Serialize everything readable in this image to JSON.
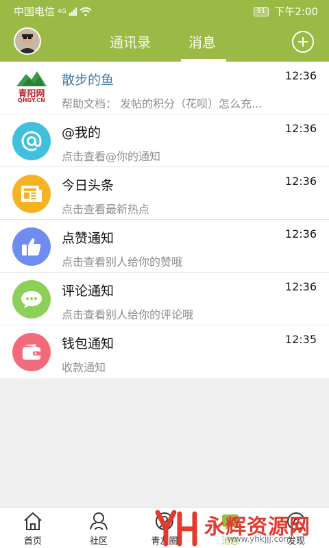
{
  "status_bar": {
    "carrier": "中国电信",
    "network": "4G",
    "battery": "91",
    "time": "下午2:00"
  },
  "header": {
    "tabs": [
      {
        "label": "通讯录",
        "active": false
      },
      {
        "label": "消息",
        "active": true
      }
    ],
    "avatar_icon": "user-avatar",
    "add_icon": "plus-circle-icon"
  },
  "messages": [
    {
      "title": "散步的鱼",
      "subtitle": "帮助文档： 发帖的积分（花呗）怎么充...",
      "time": "12:36",
      "icon": "qingyang-logo",
      "logo_text": "青阳网",
      "logo_small": "QHGY.CN"
    },
    {
      "title": "@我的",
      "subtitle": "点击查看@你的通知",
      "time": "12:36",
      "icon": "at-icon",
      "color": "#3fc0de"
    },
    {
      "title": "今日头条",
      "subtitle": "点击查看最新热点",
      "time": "12:36",
      "icon": "newspaper-icon",
      "color": "#f5b324"
    },
    {
      "title": "点赞通知",
      "subtitle": "点击查看别人给你的赞哦",
      "time": "12:36",
      "icon": "thumbs-up-icon",
      "color": "#6f8df0"
    },
    {
      "title": "评论通知",
      "subtitle": "点击查看别人给你的评论哦",
      "time": "12:36",
      "icon": "chat-bubble-icon",
      "color": "#8cd05a"
    },
    {
      "title": "钱包通知",
      "subtitle": "收款通知",
      "time": "12:35",
      "icon": "wallet-icon",
      "color": "#f26b7c"
    }
  ],
  "bottom_nav": [
    {
      "label": "首页",
      "icon": "home-icon"
    },
    {
      "label": "社区",
      "icon": "community-icon"
    },
    {
      "label": "青友圈",
      "icon": "friends-circle-icon"
    },
    {
      "label": "消息",
      "icon": "message-icon",
      "active": true
    },
    {
      "label": "发现",
      "icon": "discover-icon"
    }
  ],
  "watermark": {
    "text": "永辉资源网",
    "url": "www.yhkjjj.com"
  },
  "colors": {
    "accent": "#9bba45",
    "title_blue": "#3f7ab0"
  }
}
